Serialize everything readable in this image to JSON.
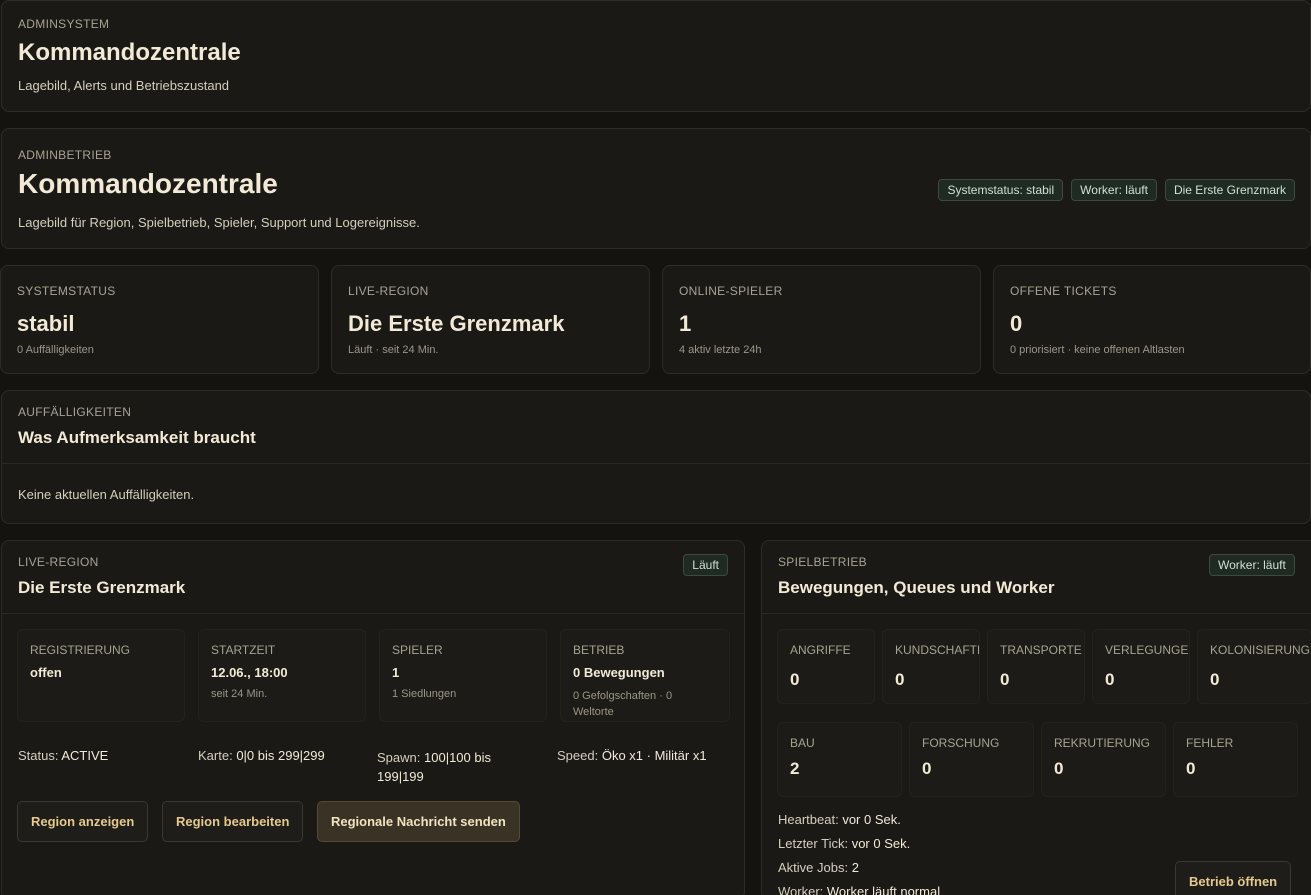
{
  "top": {
    "kicker": "ADMINSYSTEM",
    "title": "Kommandozentrale",
    "subtitle": "Lagebild, Alerts und Betriebszustand"
  },
  "header": {
    "kicker": "ADMINBETRIEB",
    "title": "Kommandozentrale",
    "subtitle": "Lagebild für Region, Spielbetrieb, Spieler, Support und Logereignisse.",
    "badges": [
      "Systemstatus: stabil",
      "Worker: läuft",
      "Die Erste Grenzmark"
    ]
  },
  "stats": [
    {
      "label": "SYSTEMSTATUS",
      "value": "stabil",
      "note": "0 Auffälligkeiten"
    },
    {
      "label": "LIVE-REGION",
      "value": "Die Erste Grenzmark",
      "note": "Läuft · seit 24 Min."
    },
    {
      "label": "ONLINE-SPIELER",
      "value": "1",
      "note": "4 aktiv letzte 24h"
    },
    {
      "label": "OFFENE TICKETS",
      "value": "0",
      "note": "0 priorisiert · keine offenen Altlasten"
    }
  ],
  "alerts": {
    "kicker": "AUFFÄLLIGKEITEN",
    "title": "Was Aufmerksamkeit braucht",
    "empty": "Keine aktuellen Auffälligkeiten."
  },
  "region": {
    "kicker": "LIVE-REGION",
    "title": "Die Erste Grenzmark",
    "badge": "Läuft",
    "cells": [
      {
        "label": "REGISTRIERUNG",
        "value": "offen",
        "note": ""
      },
      {
        "label": "STARTZEIT",
        "value": "12.06., 18:00",
        "note": "seit 24 Min."
      },
      {
        "label": "SPIELER",
        "value": "1",
        "note": "1 Siedlungen"
      },
      {
        "label": "BETRIEB",
        "value": "0 Bewegungen",
        "note": "0 Gefolgschaften · 0 Weltorte"
      }
    ],
    "facts": [
      {
        "key": "Status:",
        "val": "ACTIVE"
      },
      {
        "key": "Karte:",
        "val": "0|0 bis 299|299"
      },
      {
        "key": "Spawn:",
        "val": "100|100 bis 199|199"
      },
      {
        "key": "Speed:",
        "val": "Öko x1 · Militär x1"
      }
    ],
    "buttons": {
      "show": "Region anzeigen",
      "edit": "Region bearbeiten",
      "message": "Regionale Nachricht senden"
    }
  },
  "ops": {
    "kicker": "SPIELBETRIEB",
    "title": "Bewegungen, Queues und Worker",
    "badge": "Worker: läuft",
    "row1": [
      {
        "label": "ANGRIFFE",
        "value": "0"
      },
      {
        "label": "KUNDSCHAFTEN",
        "value": "0"
      },
      {
        "label": "TRANSPORTE",
        "value": "0"
      },
      {
        "label": "VERLEGUNGEN",
        "value": "0"
      },
      {
        "label": "KOLONISIERUNG",
        "value": "0"
      }
    ],
    "row2": [
      {
        "label": "BAU",
        "value": "2"
      },
      {
        "label": "FORSCHUNG",
        "value": "0"
      },
      {
        "label": "REKRUTIERUNG",
        "value": "0"
      },
      {
        "label": "FEHLER",
        "value": "0"
      }
    ],
    "facts": [
      {
        "key": "Heartbeat:",
        "val": "vor 0 Sek."
      },
      {
        "key": "Letzter Tick:",
        "val": "vor 0 Sek."
      },
      {
        "key": "Aktive Jobs:",
        "val": "2"
      },
      {
        "key": "Worker:",
        "val": "Worker läuft normal"
      }
    ],
    "button": "Betrieb öffnen"
  }
}
